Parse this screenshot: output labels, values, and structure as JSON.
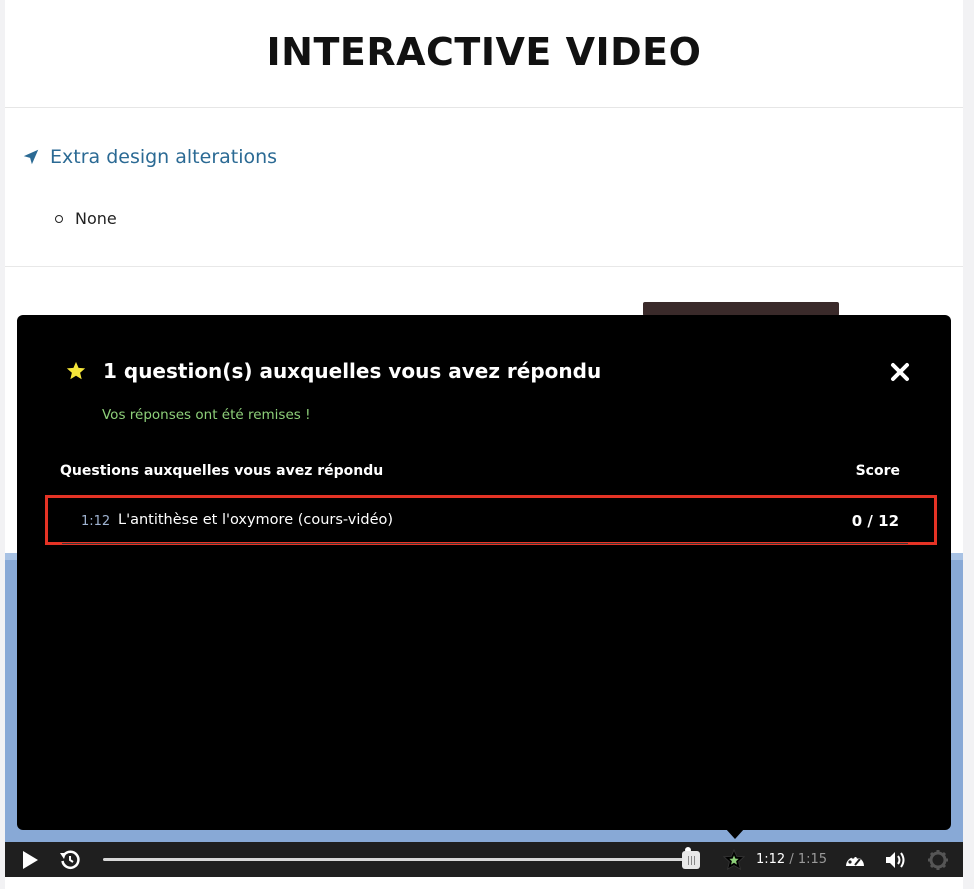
{
  "page": {
    "title": "INTERACTIVE VIDEO"
  },
  "section": {
    "heading": "Extra design alterations",
    "items": [
      "None"
    ]
  },
  "overlay": {
    "title": "1 question(s) auxquelles vous avez répondu",
    "subtitle": "Vos réponses ont été remises !",
    "columns": {
      "question": "Questions auxquelles vous avez répondu",
      "score": "Score"
    },
    "rows": [
      {
        "time": "1:12",
        "name": "L'antithèse et l'oxymore (cours-vidéo)",
        "score": "0 / 12"
      }
    ]
  },
  "player": {
    "current_time": "1:12",
    "separator": "/",
    "total_time": "1:15",
    "progress": 0.96
  },
  "colors": {
    "heading": "#2b6a94",
    "submitted": "#8ed07a",
    "highlight": "#e53325",
    "video_bg": "#88a9d6"
  }
}
